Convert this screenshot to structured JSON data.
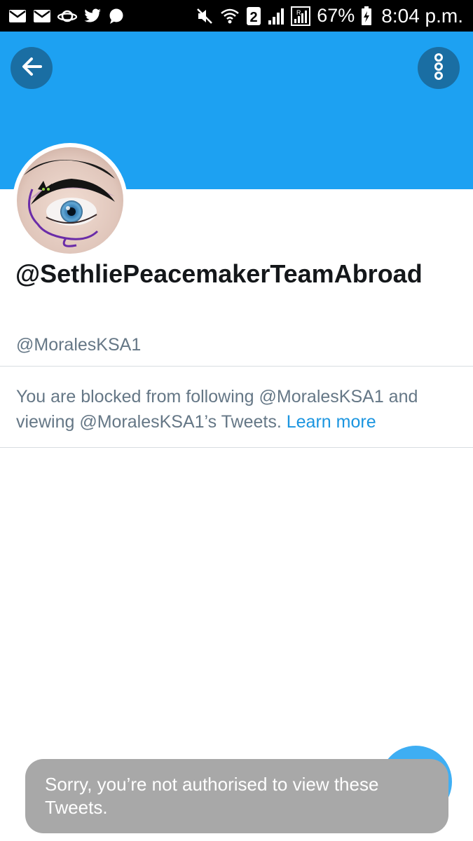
{
  "status_bar": {
    "battery_percent": "67%",
    "time": "8:04 p.m.",
    "sim_label": "2",
    "left_icons": [
      "mail-icon",
      "mail-icon",
      "planet-icon",
      "bird-icon",
      "chat-bubble-icon"
    ],
    "right_icons": [
      "mute-icon",
      "wifi-icon",
      "sim-icon",
      "signal-icon",
      "roaming-signal-icon",
      "battery-charging-icon"
    ]
  },
  "header": {
    "banner_color": "#1da1f2",
    "back_icon": "arrow-left-icon",
    "more_icon": "more-vertical-icon"
  },
  "profile": {
    "display_name": "@SethliePeacemakerTeamAbroad",
    "handle": "@MoralesKSA1"
  },
  "blocked_notice": {
    "text": "You are blocked from following @MoralesKSA1 and viewing @MoralesKSA1’s Tweets.",
    "link": "Learn more",
    "link_color": "#1b95e0"
  },
  "toast": {
    "message": "Sorry, you’re not authorised to view these Tweets."
  },
  "fab": {
    "icon": "compose-tweet-icon",
    "color": "#1da1f2"
  }
}
